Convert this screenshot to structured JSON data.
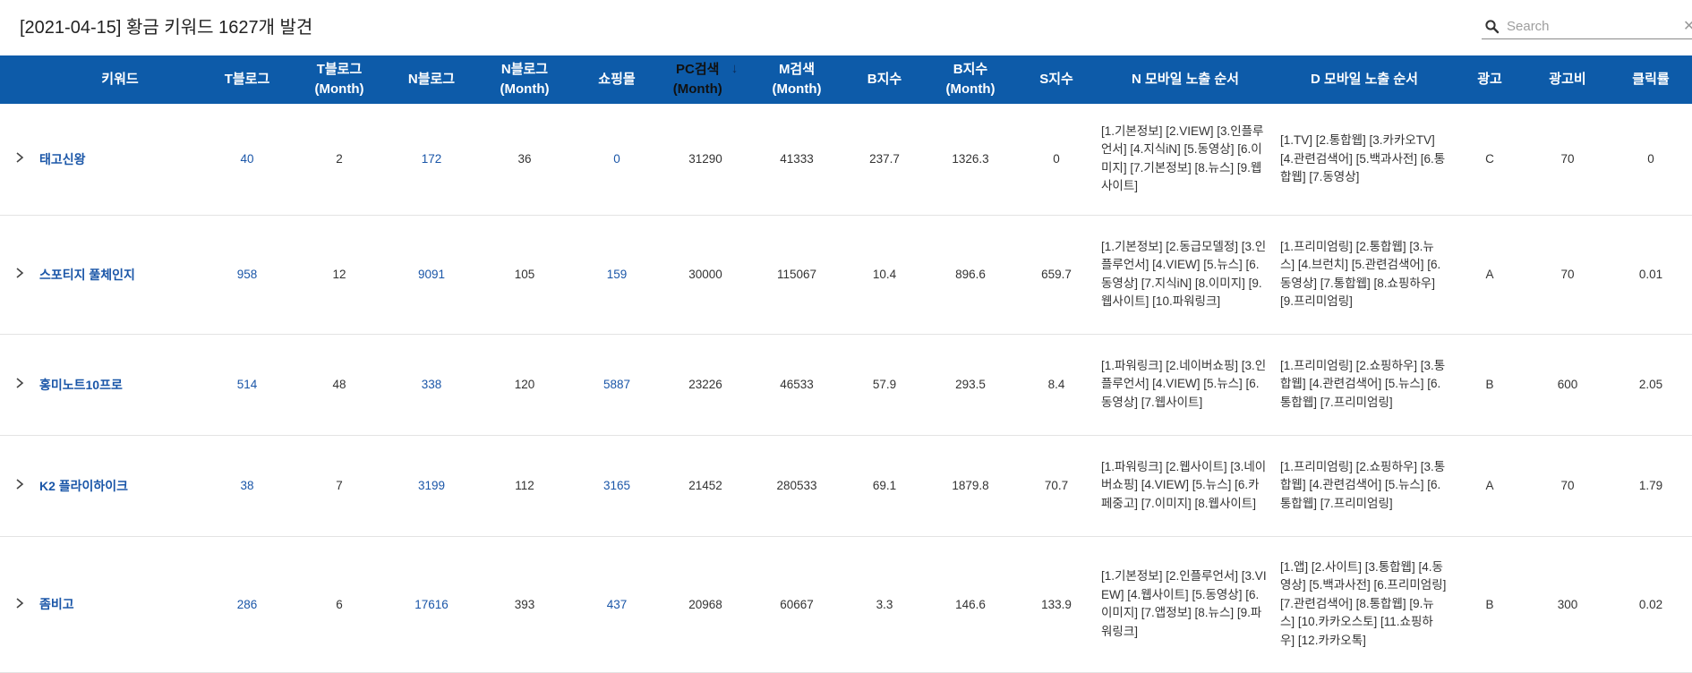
{
  "header": {
    "title": "[2021-04-15] 황금 키워드 1627개 발견",
    "search_placeholder": "Search"
  },
  "columns": {
    "keyword": "키워드",
    "t_blog": "T블로그",
    "t_blog_month_1": "T블로그",
    "t_blog_month_2": "(Month)",
    "n_blog": "N블로그",
    "n_blog_month_1": "N블로그",
    "n_blog_month_2": "(Month)",
    "shopping": "쇼핑몰",
    "pc_search_1": "PC검색",
    "pc_search_2": "(Month)",
    "m_search_1": "M검색",
    "m_search_2": "(Month)",
    "b_index": "B지수",
    "b_index_month_1": "B지수",
    "b_index_month_2": "(Month)",
    "s_index": "S지수",
    "n_mobile_order": "N 모바일 노출 순서",
    "d_mobile_order": "D 모바일 노출 순서",
    "ad": "광고",
    "ad_cost": "광고비",
    "ctr": "클릭률"
  },
  "sort": {
    "column": "pc_search",
    "direction": "desc"
  },
  "rows": [
    {
      "keyword": "태고신왕",
      "t_blog": "40",
      "t_blog_month": "2",
      "n_blog": "172",
      "n_blog_month": "36",
      "shopping": "0",
      "pc_search": "31290",
      "m_search": "41333",
      "b_index": "237.7",
      "b_index_month": "1326.3",
      "s_index": "0",
      "n_order": "[1.기본정보] [2.VIEW] [3.인플루언서] [4.지식iN] [5.동영상] [6.이미지] [7.기본정보] [8.뉴스] [9.웹사이트]",
      "d_order": "[1.TV] [2.통합웹] [3.카카오TV] [4.관련검색어] [5.백과사전] [6.통합웹] [7.동영상]",
      "ad": "C",
      "ad_cost": "70",
      "ctr": "0"
    },
    {
      "keyword": "스포티지 풀체인지",
      "t_blog": "958",
      "t_blog_month": "12",
      "n_blog": "9091",
      "n_blog_month": "105",
      "shopping": "159",
      "pc_search": "30000",
      "m_search": "115067",
      "b_index": "10.4",
      "b_index_month": "896.6",
      "s_index": "659.7",
      "n_order": "[1.기본정보] [2.동급모델정] [3.인플루언서] [4.VIEW] [5.뉴스] [6.동영상] [7.지식iN] [8.이미지] [9.웹사이트] [10.파워링크]",
      "d_order": "[1.프리미엄링] [2.통합웹] [3.뉴스] [4.브런치] [5.관련검색어] [6.동영상] [7.통합웹] [8.쇼핑하우] [9.프리미엄링]",
      "ad": "A",
      "ad_cost": "70",
      "ctr": "0.01"
    },
    {
      "keyword": "홍미노트10프로",
      "t_blog": "514",
      "t_blog_month": "48",
      "n_blog": "338",
      "n_blog_month": "120",
      "shopping": "5887",
      "pc_search": "23226",
      "m_search": "46533",
      "b_index": "57.9",
      "b_index_month": "293.5",
      "s_index": "8.4",
      "n_order": "[1.파워링크] [2.네이버쇼핑] [3.인플루언서] [4.VIEW] [5.뉴스] [6.동영상] [7.웹사이트]",
      "d_order": "[1.프리미엄링] [2.쇼핑하우] [3.통합웹] [4.관련검색어] [5.뉴스] [6.통합웹] [7.프리미엄링]",
      "ad": "B",
      "ad_cost": "600",
      "ctr": "2.05"
    },
    {
      "keyword": "K2 플라이하이크",
      "t_blog": "38",
      "t_blog_month": "7",
      "n_blog": "3199",
      "n_blog_month": "112",
      "shopping": "3165",
      "pc_search": "21452",
      "m_search": "280533",
      "b_index": "69.1",
      "b_index_month": "1879.8",
      "s_index": "70.7",
      "n_order": "[1.파워링크] [2.웹사이트] [3.네이버쇼핑] [4.VIEW] [5.뉴스] [6.카페중고] [7.이미지] [8.웹사이트]",
      "d_order": "[1.프리미엄링] [2.쇼핑하우] [3.통합웹] [4.관련검색어] [5.뉴스] [6.통합웹] [7.프리미엄링]",
      "ad": "A",
      "ad_cost": "70",
      "ctr": "1.79"
    },
    {
      "keyword": "좀비고",
      "t_blog": "286",
      "t_blog_month": "6",
      "n_blog": "17616",
      "n_blog_month": "393",
      "shopping": "437",
      "pc_search": "20968",
      "m_search": "60667",
      "b_index": "3.3",
      "b_index_month": "146.6",
      "s_index": "133.9",
      "n_order": "[1.기본정보] [2.인플루언서] [3.VIEW] [4.웹사이트] [5.동영상] [6.이미지] [7.앱정보] [8.뉴스] [9.파워링크]",
      "d_order": "[1.앱] [2.사이트] [3.통합웹] [4.동영상] [5.백과사전] [6.프리미엄링] [7.관련검색어] [8.통합웹] [9.뉴스] [10.카카오스토] [11.쇼핑하우] [12.카카오톡]",
      "ad": "B",
      "ad_cost": "300",
      "ctr": "0.02"
    }
  ],
  "theme": {
    "header_bg": "#0d5ba9",
    "link": "#1a56a8"
  }
}
